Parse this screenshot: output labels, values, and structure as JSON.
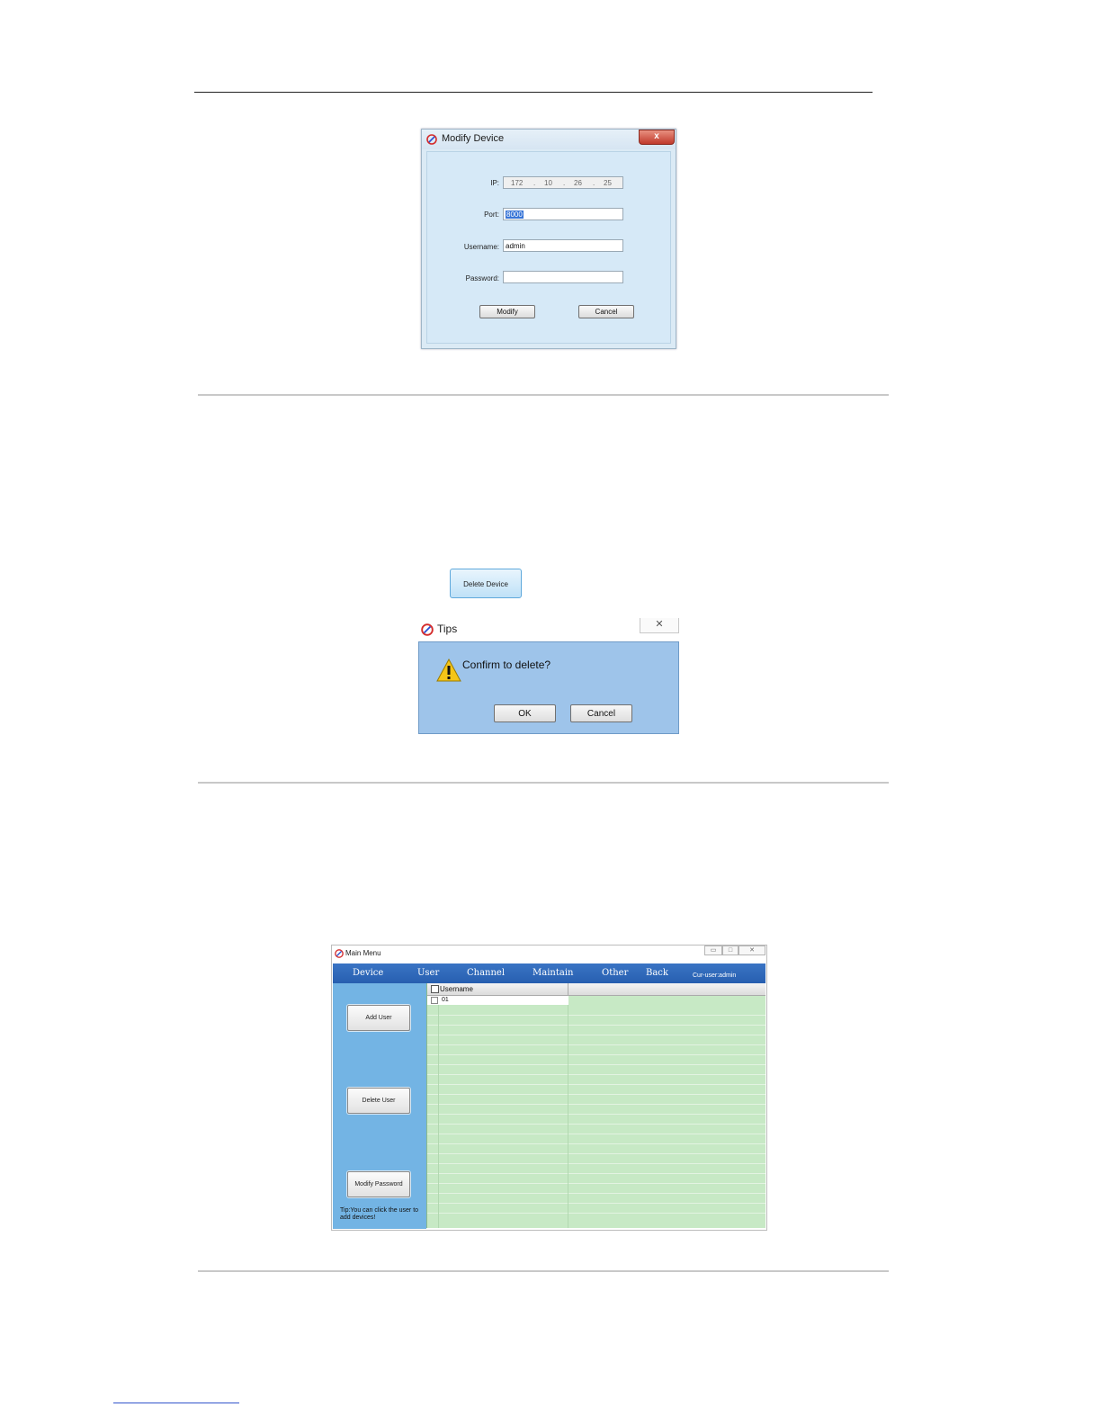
{
  "modify_device": {
    "title": "Modify Device",
    "close": "x",
    "ip_label": "IP:",
    "ip": [
      "172",
      "10",
      "26",
      "25"
    ],
    "ip_dot": ".",
    "port_label": "Port:",
    "port": "8000",
    "username_label": "Username:",
    "username": "admin",
    "password_label": "Password:",
    "password": "",
    "modify_button": "Modify",
    "cancel_button": "Cancel"
  },
  "delete_device_button": "Delete Device",
  "tips": {
    "title": "Tips",
    "close": "✕",
    "message": "Confirm to delete?",
    "ok_button": "OK",
    "cancel_button": "Cancel"
  },
  "main_menu": {
    "title": "Main Menu",
    "controls": [
      "▭",
      "□",
      "✕"
    ],
    "nav": [
      "Device",
      "User",
      "Channel",
      "Maintain",
      "Other",
      "Back"
    ],
    "cur_user": "Cur-user:admin",
    "add_user": "Add User",
    "delete_user": "Delete User",
    "modify_password": "Modify Password",
    "tip": "Tip:You can click the user to add devices!",
    "column_header": "Username",
    "rows": [
      "01"
    ]
  },
  "colors": {
    "nav_bar": "#2f68bb",
    "sidebar": "#73b4e4",
    "grid": "#c7e9c5",
    "tips_body": "#9ec4ea",
    "dialog_body": "#d6e9f7"
  }
}
